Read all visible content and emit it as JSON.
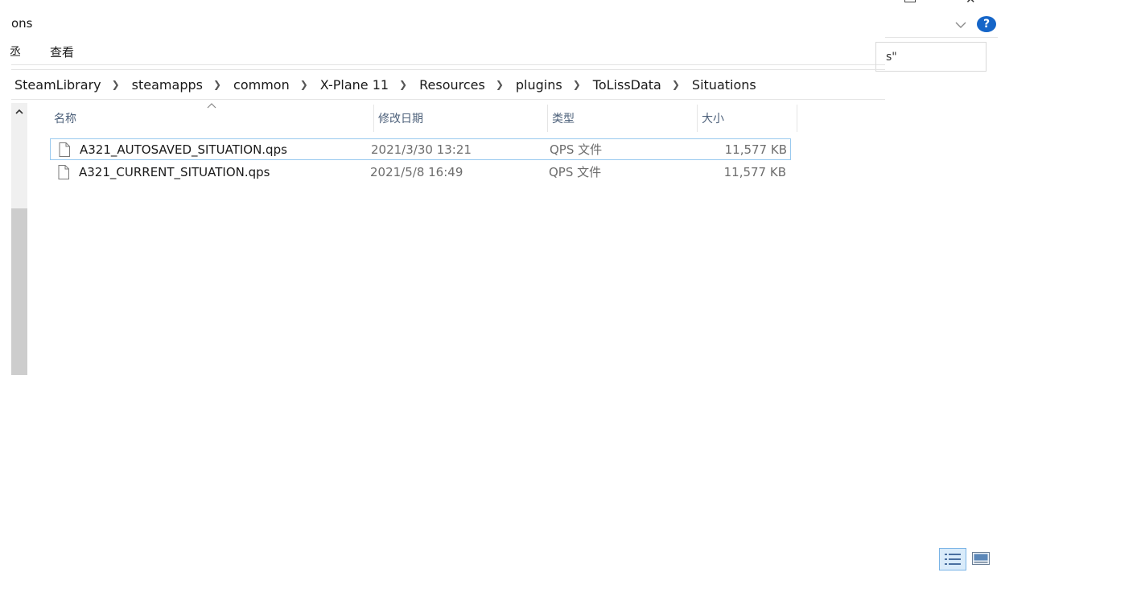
{
  "window": {
    "title_partial": "ons"
  },
  "menu": {
    "partial_label": "丞",
    "view_label": "查看"
  },
  "search": {
    "partial_text": "s\""
  },
  "breadcrumb": [
    "SteamLibrary",
    "steamapps",
    "common",
    "X-Plane 11",
    "Resources",
    "plugins",
    "ToLissData",
    "Situations"
  ],
  "columns": {
    "name": "名称",
    "date": "修改日期",
    "type": "类型",
    "size": "大小"
  },
  "files": [
    {
      "name": "A321_AUTOSAVED_SITUATION.qps",
      "date": "2021/3/30 13:21",
      "type": "QPS 文件",
      "size": "11,577 KB",
      "selected": true
    },
    {
      "name": "A321_CURRENT_SITUATION.qps",
      "date": "2021/5/8 16:49",
      "type": "QPS 文件",
      "size": "11,577 KB",
      "selected": false
    }
  ],
  "help": {
    "label": "?"
  },
  "colors": {
    "accent": "#1565c8",
    "selection_border": "#99c9ef",
    "header_text": "#4c607a"
  },
  "icons": {
    "help": "help-icon",
    "ribbon_expand": "chevron-down-icon",
    "file": "file-icon",
    "sort": "sort-up-icon",
    "breadcrumb_separator": "chevron-right-icon",
    "details_view": "details-view-icon",
    "large_icons_view": "large-icons-view-icon"
  }
}
